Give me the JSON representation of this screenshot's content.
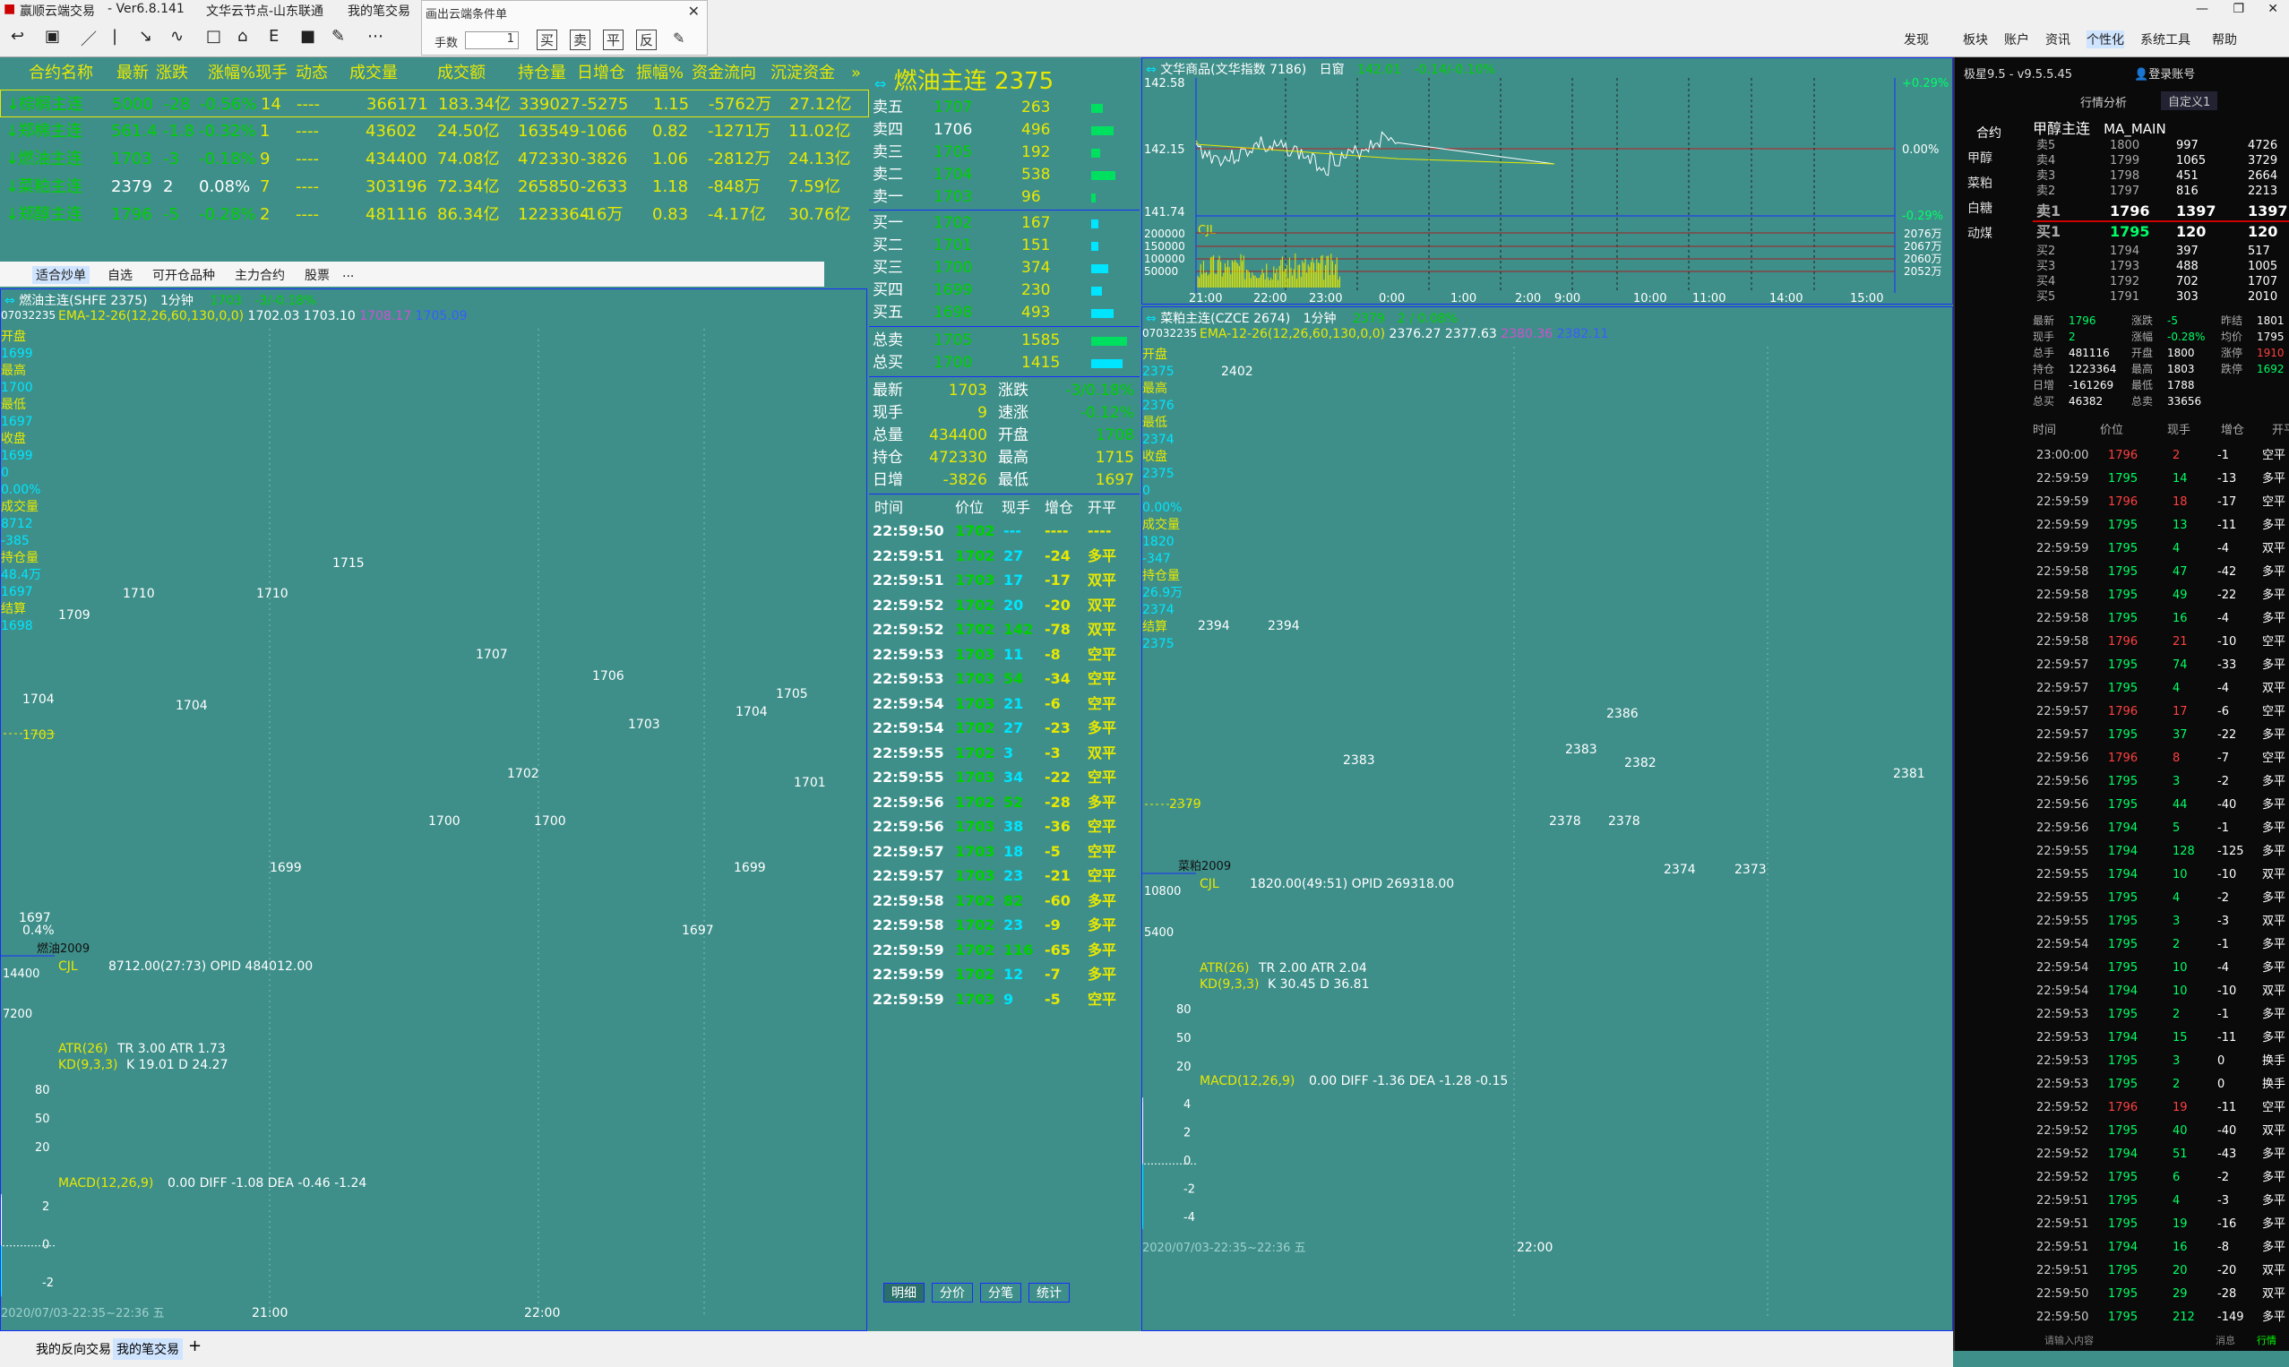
{
  "window": {
    "title": "赢顺云端交易",
    "version": "- Ver6.8.141",
    "menus": [
      "文华云节点-山东联通",
      "我的笔交易"
    ]
  },
  "cond_dialog": {
    "title": "画出云端条件单",
    "qty_label": "手数",
    "qty_value": "1",
    "buttons": [
      "买",
      "卖",
      "平",
      "反"
    ]
  },
  "right_menu": [
    "发现",
    "板块",
    "账户",
    "资讯",
    "个性化",
    "系统工具",
    "帮助"
  ],
  "watch_headers": [
    "合约名称",
    "最新",
    "涨跌",
    "涨幅%现手",
    "动态",
    "成交量",
    "成交额",
    "持仓量",
    "日增仓",
    "振幅%",
    "资金流向",
    "沉淀资金"
  ],
  "watch_rows": [
    {
      "name": "棕榈主连",
      "last": "5000",
      "chg": "-28",
      "pct": "-0.56%",
      "vol_now": "14",
      "dyn": "----",
      "vol": "366171",
      "amt": "183.34亿",
      "oi": "339027",
      "oi_chg": "-5275",
      "amp": "1.15",
      "flow": "-5762万",
      "settled": "27.12亿"
    },
    {
      "name": "郑棉主连",
      "last": "561.4",
      "chg": "-1.8",
      "pct": "-0.32%",
      "vol_now": "1",
      "dyn": "----",
      "vol": "43602",
      "amt": "24.50亿",
      "oi": "163549",
      "oi_chg": "-1066",
      "amp": "0.82",
      "flow": "-1271万",
      "settled": "11.02亿"
    },
    {
      "name": "燃油主连",
      "last": "1703",
      "chg": "-3",
      "pct": "-0.18%",
      "vol_now": "9",
      "dyn": "----",
      "vol": "434400",
      "amt": "74.08亿",
      "oi": "472330",
      "oi_chg": "-3826",
      "amp": "1.06",
      "flow": "-2812万",
      "settled": "24.13亿"
    },
    {
      "name": "菜粕主连",
      "last": "2379",
      "chg": "2",
      "pct": "0.08%",
      "vol_now": "7",
      "dyn": "----",
      "vol": "303196",
      "amt": "72.34亿",
      "oi": "265850",
      "oi_chg": "-2633",
      "amp": "1.18",
      "flow": "-848万",
      "settled": "7.59亿"
    },
    {
      "name": "郑醇主连",
      "last": "1796",
      "chg": "-5",
      "pct": "-0.28%",
      "vol_now": "2",
      "dyn": "----",
      "vol": "481116",
      "amt": "86.34亿",
      "oi": "1223364",
      "oi_chg": "-16万",
      "amp": "0.83",
      "flow": "-4.17亿",
      "settled": "30.76亿"
    }
  ],
  "sub_tabs": [
    "适合炒单",
    "自选",
    "可开仓品种",
    "主力合约",
    "股票",
    "..."
  ],
  "left_chart": {
    "title": "燃油主连(SHFE 2375)",
    "period": "1分钟",
    "price": "1703",
    "chg": "-3/-0.18%",
    "code": "07032235",
    "ema": "EMA-12-26(12,26,60,130,0,0)",
    "ema_vals": [
      "1702.03",
      "1703.10",
      "1708.17",
      "1705.09"
    ],
    "side": [
      [
        "开盘",
        "1699"
      ],
      [
        "最高",
        "1700"
      ],
      [
        "最低",
        "1697"
      ],
      [
        "收盘",
        "1699"
      ],
      [
        "",
        "0"
      ],
      [
        "",
        "0.00%"
      ],
      [
        "成交量",
        "8712"
      ],
      [
        "",
        "-385"
      ],
      [
        "持仓量",
        "48.4万"
      ],
      [
        "",
        "1697"
      ],
      [
        "结算",
        "1698"
      ]
    ],
    "price_labels": [
      "1715",
      "1710",
      "1710",
      "1709",
      "1707",
      "1706",
      "1705",
      "1704",
      "1704",
      "1703",
      "1702",
      "1701",
      "1700",
      "1700",
      "1699",
      "1699",
      "1697"
    ],
    "y_labels": [
      "1704",
      "1703",
      "1697",
      "0.4%"
    ],
    "sub_label": "燃油2009",
    "vol_title": "CJL",
    "vol_vals": "8712.00(27:73)  OPID 484012.00",
    "vol_y": [
      "14400",
      "7200"
    ],
    "atr_title": "ATR(26)",
    "atr_vals": "TR 3.00  ATR 1.73",
    "kd_title": "KD(9,3,3)",
    "kd_vals": "K 19.01  D 24.27",
    "kd_y": [
      "80",
      "50",
      "20"
    ],
    "macd_title": "MACD(12,26,9)",
    "macd_vals": "0.00  DIFF -1.08  DEA -0.46  -1.24",
    "macd_y": [
      "2",
      "0",
      "-2"
    ],
    "x_labels": [
      "21:00",
      "22:00"
    ],
    "footer": "2020/07/03-22:35~22:36 五"
  },
  "book": {
    "title": "燃油主连",
    "code": "2375",
    "asks": [
      [
        "卖五",
        "1707",
        "263"
      ],
      [
        "卖四",
        "1706",
        "496"
      ],
      [
        "卖三",
        "1705",
        "192"
      ],
      [
        "卖二",
        "1704",
        "538"
      ],
      [
        "卖一",
        "1703",
        "96"
      ]
    ],
    "bids": [
      [
        "买一",
        "1702",
        "167"
      ],
      [
        "买二",
        "1701",
        "151"
      ],
      [
        "买三",
        "1700",
        "374"
      ],
      [
        "买四",
        "1699",
        "230"
      ],
      [
        "买五",
        "1698",
        "493"
      ]
    ],
    "totals": [
      [
        "总卖",
        "1705",
        "1585"
      ],
      [
        "总买",
        "1700",
        "1415"
      ]
    ],
    "stats": [
      [
        "最新",
        "1703",
        "涨跌",
        "-3/0.18%"
      ],
      [
        "现手",
        "9",
        "速涨",
        "-0.12%"
      ],
      [
        "总量",
        "434400",
        "开盘",
        "1708"
      ],
      [
        "持仓",
        "472330",
        "最高",
        "1715"
      ],
      [
        "日增",
        "-3826",
        "最低",
        "1697"
      ]
    ],
    "tick_headers": [
      "时间",
      "价位",
      "现手",
      "增仓",
      "开平"
    ],
    "ticks": [
      [
        "22:59:50",
        "1702",
        "---",
        "----",
        "----"
      ],
      [
        "22:59:51",
        "1702",
        "27",
        "-24",
        "多平"
      ],
      [
        "22:59:51",
        "1703",
        "17",
        "-17",
        "双平"
      ],
      [
        "22:59:52",
        "1702",
        "20",
        "-20",
        "双平"
      ],
      [
        "22:59:52",
        "1702",
        "142",
        "-78",
        "双平"
      ],
      [
        "22:59:53",
        "1703",
        "11",
        "-8",
        "空平"
      ],
      [
        "22:59:53",
        "1703",
        "54",
        "-34",
        "空平"
      ],
      [
        "22:59:54",
        "1703",
        "21",
        "-6",
        "空平"
      ],
      [
        "22:59:54",
        "1702",
        "27",
        "-23",
        "多平"
      ],
      [
        "22:59:55",
        "1702",
        "3",
        "-3",
        "双平"
      ],
      [
        "22:59:55",
        "1703",
        "34",
        "-22",
        "空平"
      ],
      [
        "22:59:56",
        "1702",
        "52",
        "-28",
        "多平"
      ],
      [
        "22:59:56",
        "1703",
        "38",
        "-36",
        "空平"
      ],
      [
        "22:59:57",
        "1703",
        "18",
        "-5",
        "空平"
      ],
      [
        "22:59:57",
        "1703",
        "23",
        "-21",
        "空平"
      ],
      [
        "22:59:58",
        "1702",
        "82",
        "-60",
        "多平"
      ],
      [
        "22:59:58",
        "1702",
        "23",
        "-9",
        "多平"
      ],
      [
        "22:59:59",
        "1702",
        "116",
        "-65",
        "多平"
      ],
      [
        "22:59:59",
        "1702",
        "12",
        "-7",
        "多平"
      ],
      [
        "22:59:59",
        "1703",
        "9",
        "-5",
        "空平"
      ]
    ],
    "bottom_tabs": [
      "明细",
      "分价",
      "分笔",
      "统计"
    ]
  },
  "index_chart": {
    "title": "文华商品(文华指数 7186)",
    "period": "日窗",
    "price": "142.01",
    "chg": "-0.14/-0.10%",
    "y_left": [
      "142.58",
      "142.15",
      "141.74"
    ],
    "y_right": [
      "+0.29%",
      "0.00%",
      "-0.29%"
    ],
    "vol_label": "CJL",
    "vol_y": [
      "200000",
      "150000",
      "100000",
      "50000"
    ],
    "vol_right": [
      "2076万",
      "2067万",
      "2060万",
      "2052万"
    ],
    "x": [
      "21:00",
      "22:00",
      "23:00",
      "0:00",
      "1:00",
      "2:00",
      "9:00",
      "10:00",
      "11:00",
      "14:00",
      "15:00"
    ]
  },
  "right_chart": {
    "title": "菜粕主连(CZCE 2674)",
    "period": "1分钟",
    "price": "2379",
    "chg": "2 / 0.08%",
    "code": "07032235",
    "ema": "EMA-12-26(12,26,60,130,0,0)",
    "ema_vals": [
      "2376.27",
      "2377.63",
      "2380.36",
      "2382.11"
    ],
    "side": [
      [
        "开盘",
        "2375"
      ],
      [
        "最高",
        "2376"
      ],
      [
        "最低",
        "2374"
      ],
      [
        "收盘",
        "2375"
      ],
      [
        "",
        "0"
      ],
      [
        "",
        "0.00%"
      ],
      [
        "成交量",
        "1820"
      ],
      [
        "",
        "-347"
      ],
      [
        "持仓量",
        "26.9万"
      ],
      [
        "",
        "2374"
      ],
      [
        "结算",
        "2375"
      ]
    ],
    "price_labels": [
      "2402",
      "2394",
      "2394",
      "2386",
      "2383",
      "2383",
      "2382",
      "2381",
      "2378",
      "2378",
      "2374",
      "2373"
    ],
    "y_labels": [
      "2379"
    ],
    "sub_label": "菜粕2009",
    "vol_title": "CJL",
    "vol_vals": "1820.00(49:51)  OPID 269318.00",
    "vol_y": [
      "10800",
      "5400"
    ],
    "atr_title": "ATR(26)",
    "atr_vals": "TR 2.00  ATR 2.04",
    "kd_title": "KD(9,3,3)",
    "kd_vals": "K 30.45  D 36.81",
    "kd_y": [
      "80",
      "50",
      "20"
    ],
    "macd_title": "MACD(12,26,9)",
    "macd_vals": "0.00  DIFF -1.36  DEA -1.28  -0.15",
    "macd_y": [
      "4",
      "2",
      "0",
      "-2",
      "-4"
    ],
    "x_labels": [
      "22:00"
    ],
    "footer": "2020/07/03-22:35~22:36 五"
  },
  "dark": {
    "app": "极星9.5 - v9.5.5.45",
    "login": "登录账号",
    "tabs": [
      "行情分析",
      "自定义1"
    ],
    "side_items": [
      "合约",
      "甲醇",
      "菜粕",
      "白糖",
      "动煤"
    ],
    "contract": "甲醇主连",
    "indicator": "MA_MAIN",
    "asks": [
      [
        "卖5",
        "1800",
        "997",
        "4726"
      ],
      [
        "卖4",
        "1799",
        "1065",
        "3729"
      ],
      [
        "卖3",
        "1798",
        "451",
        "2664"
      ],
      [
        "卖2",
        "1797",
        "816",
        "2213"
      ],
      [
        "卖1",
        "1796",
        "1397",
        "1397"
      ]
    ],
    "bids": [
      [
        "买1",
        "1795",
        "120",
        "120"
      ],
      [
        "买2",
        "1794",
        "397",
        "517"
      ],
      [
        "买3",
        "1793",
        "488",
        "1005"
      ],
      [
        "买4",
        "1792",
        "702",
        "1707"
      ],
      [
        "买5",
        "1791",
        "303",
        "2010"
      ]
    ],
    "stats": [
      [
        "最新",
        "1796",
        "涨跌",
        "-5",
        "昨结",
        "1801"
      ],
      [
        "现手",
        "2",
        "涨幅",
        "-0.28%",
        "均价",
        "1795"
      ],
      [
        "总手",
        "481116",
        "开盘",
        "1800",
        "涨停",
        "1910"
      ],
      [
        "持仓",
        "1223364",
        "最高",
        "1803",
        "跌停",
        "1692"
      ],
      [
        "日增",
        "-161269",
        "最低",
        "1788",
        "",
        ""
      ],
      [
        "总买",
        "46382",
        "总卖",
        "33656",
        "",
        ""
      ]
    ],
    "tick_headers": [
      "时间",
      "价位",
      "现手",
      "增仓",
      "开平"
    ],
    "ticks": [
      [
        "23:00:00",
        "1796",
        "2",
        "-1",
        "空平"
      ],
      [
        "22:59:59",
        "1795",
        "14",
        "-13",
        "多平"
      ],
      [
        "22:59:59",
        "1796",
        "18",
        "-17",
        "空平"
      ],
      [
        "22:59:59",
        "1795",
        "13",
        "-11",
        "多平"
      ],
      [
        "22:59:59",
        "1795",
        "4",
        "-4",
        "双平"
      ],
      [
        "22:59:58",
        "1795",
        "47",
        "-42",
        "多平"
      ],
      [
        "22:59:58",
        "1795",
        "49",
        "-22",
        "多平"
      ],
      [
        "22:59:58",
        "1795",
        "16",
        "-4",
        "多平"
      ],
      [
        "22:59:58",
        "1796",
        "21",
        "-10",
        "空平"
      ],
      [
        "22:59:57",
        "1795",
        "74",
        "-33",
        "多平"
      ],
      [
        "22:59:57",
        "1795",
        "4",
        "-4",
        "双平"
      ],
      [
        "22:59:57",
        "1796",
        "17",
        "-6",
        "空平"
      ],
      [
        "22:59:57",
        "1795",
        "37",
        "-22",
        "多平"
      ],
      [
        "22:59:56",
        "1796",
        "8",
        "-7",
        "空平"
      ],
      [
        "22:59:56",
        "1795",
        "3",
        "-2",
        "多平"
      ],
      [
        "22:59:56",
        "1795",
        "44",
        "-40",
        "多平"
      ],
      [
        "22:59:56",
        "1794",
        "5",
        "-1",
        "多平"
      ],
      [
        "22:59:55",
        "1794",
        "128",
        "-125",
        "多平"
      ],
      [
        "22:59:55",
        "1794",
        "10",
        "-10",
        "双平"
      ],
      [
        "22:59:55",
        "1795",
        "4",
        "-2",
        "多平"
      ],
      [
        "22:59:55",
        "1795",
        "3",
        "-3",
        "双平"
      ],
      [
        "22:59:54",
        "1795",
        "2",
        "-1",
        "多平"
      ],
      [
        "22:59:54",
        "1795",
        "10",
        "-4",
        "多平"
      ],
      [
        "22:59:54",
        "1794",
        "10",
        "-10",
        "双平"
      ],
      [
        "22:59:53",
        "1795",
        "2",
        "-1",
        "多平"
      ],
      [
        "22:59:53",
        "1794",
        "15",
        "-11",
        "多平"
      ],
      [
        "22:59:53",
        "1795",
        "3",
        "0",
        "换手"
      ],
      [
        "22:59:53",
        "1795",
        "2",
        "0",
        "换手"
      ],
      [
        "22:59:52",
        "1796",
        "19",
        "-11",
        "空平"
      ],
      [
        "22:59:52",
        "1795",
        "40",
        "-40",
        "双平"
      ],
      [
        "22:59:52",
        "1794",
        "51",
        "-43",
        "多平"
      ],
      [
        "22:59:52",
        "1795",
        "6",
        "-2",
        "多平"
      ],
      [
        "22:59:51",
        "1795",
        "4",
        "-3",
        "多平"
      ],
      [
        "22:59:51",
        "1795",
        "19",
        "-16",
        "多平"
      ],
      [
        "22:59:51",
        "1794",
        "16",
        "-8",
        "多平"
      ],
      [
        "22:59:51",
        "1795",
        "20",
        "-20",
        "双平"
      ],
      [
        "22:59:50",
        "1795",
        "29",
        "-28",
        "双平"
      ],
      [
        "22:59:50",
        "1795",
        "212",
        "-149",
        "多平"
      ]
    ],
    "footer": [
      "请输入内容",
      "消息",
      "行情"
    ]
  },
  "bottom_tabs": [
    "我的反向交易",
    "我的笔交易",
    "+"
  ]
}
